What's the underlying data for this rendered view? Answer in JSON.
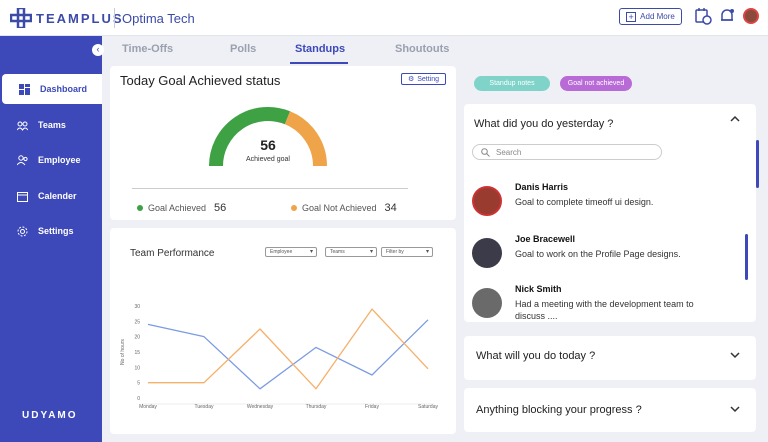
{
  "header": {
    "brand": "TEAMPLUS",
    "org": "Optima Tech",
    "add_more_label": "Add More"
  },
  "sidebar": {
    "items": [
      {
        "label": "Dashboard",
        "icon": "dashboard-icon",
        "active": true
      },
      {
        "label": "Teams",
        "icon": "teams-icon"
      },
      {
        "label": "Employee",
        "icon": "employee-icon"
      },
      {
        "label": "Calender",
        "icon": "calendar-icon"
      },
      {
        "label": "Settings",
        "icon": "gear-icon"
      }
    ],
    "footer_logo": "UDYAMO"
  },
  "tabs": [
    {
      "label": "Time-Offs"
    },
    {
      "label": "Polls"
    },
    {
      "label": "Standups",
      "active": true
    },
    {
      "label": "Shoutouts"
    }
  ],
  "goal_status": {
    "title": "Today Goal Achieved status",
    "setting_label": "Setting",
    "value": "56",
    "value_label": "Achieved goal",
    "achieved_label": "Goal Achieved",
    "achieved_value": "56",
    "not_achieved_label": "Goal Not Achieved",
    "not_achieved_value": "34",
    "achieved_color": "#3ea144",
    "not_achieved_color": "#f0a44a"
  },
  "team_performance": {
    "title": "Team Performance",
    "filters": [
      "Employee",
      "Teams",
      "Filter by"
    ]
  },
  "chart_data": {
    "type": "line",
    "categories": [
      "Monday",
      "Tuesday",
      "Wednesday",
      "Thursday",
      "Friday",
      "Saturday"
    ],
    "ylabel": "No of hours",
    "yticks": [
      0,
      5,
      10,
      15,
      20,
      25,
      30
    ],
    "ylim": [
      0,
      30
    ],
    "grid": false,
    "series": [
      {
        "color": "#7b9be3",
        "values": [
          24,
          20,
          3,
          16.5,
          7.5,
          25.5
        ]
      },
      {
        "color": "#f5b06a",
        "values": [
          5,
          5,
          22.5,
          3,
          29,
          9.5
        ]
      }
    ]
  },
  "standups": {
    "pills": [
      {
        "label": "Standup notes",
        "color": "#7fd3c9"
      },
      {
        "label": "Goal not achieved",
        "color": "#b86bd6"
      }
    ],
    "yesterday_title": "What did you do yesterday ?",
    "search_placeholder": "Search",
    "people": [
      {
        "name": "Danis Harris",
        "text": "Goal to complete timeoff ui design."
      },
      {
        "name": "Joe Bracewell",
        "text": "Goal to work on the Profile Page designs."
      },
      {
        "name": "Nick Smith",
        "text": "Had a meeting with the development team to discuss ...."
      }
    ],
    "today_title": "What will you do today ?",
    "blocking_title": "Anything blocking your progress ?"
  }
}
